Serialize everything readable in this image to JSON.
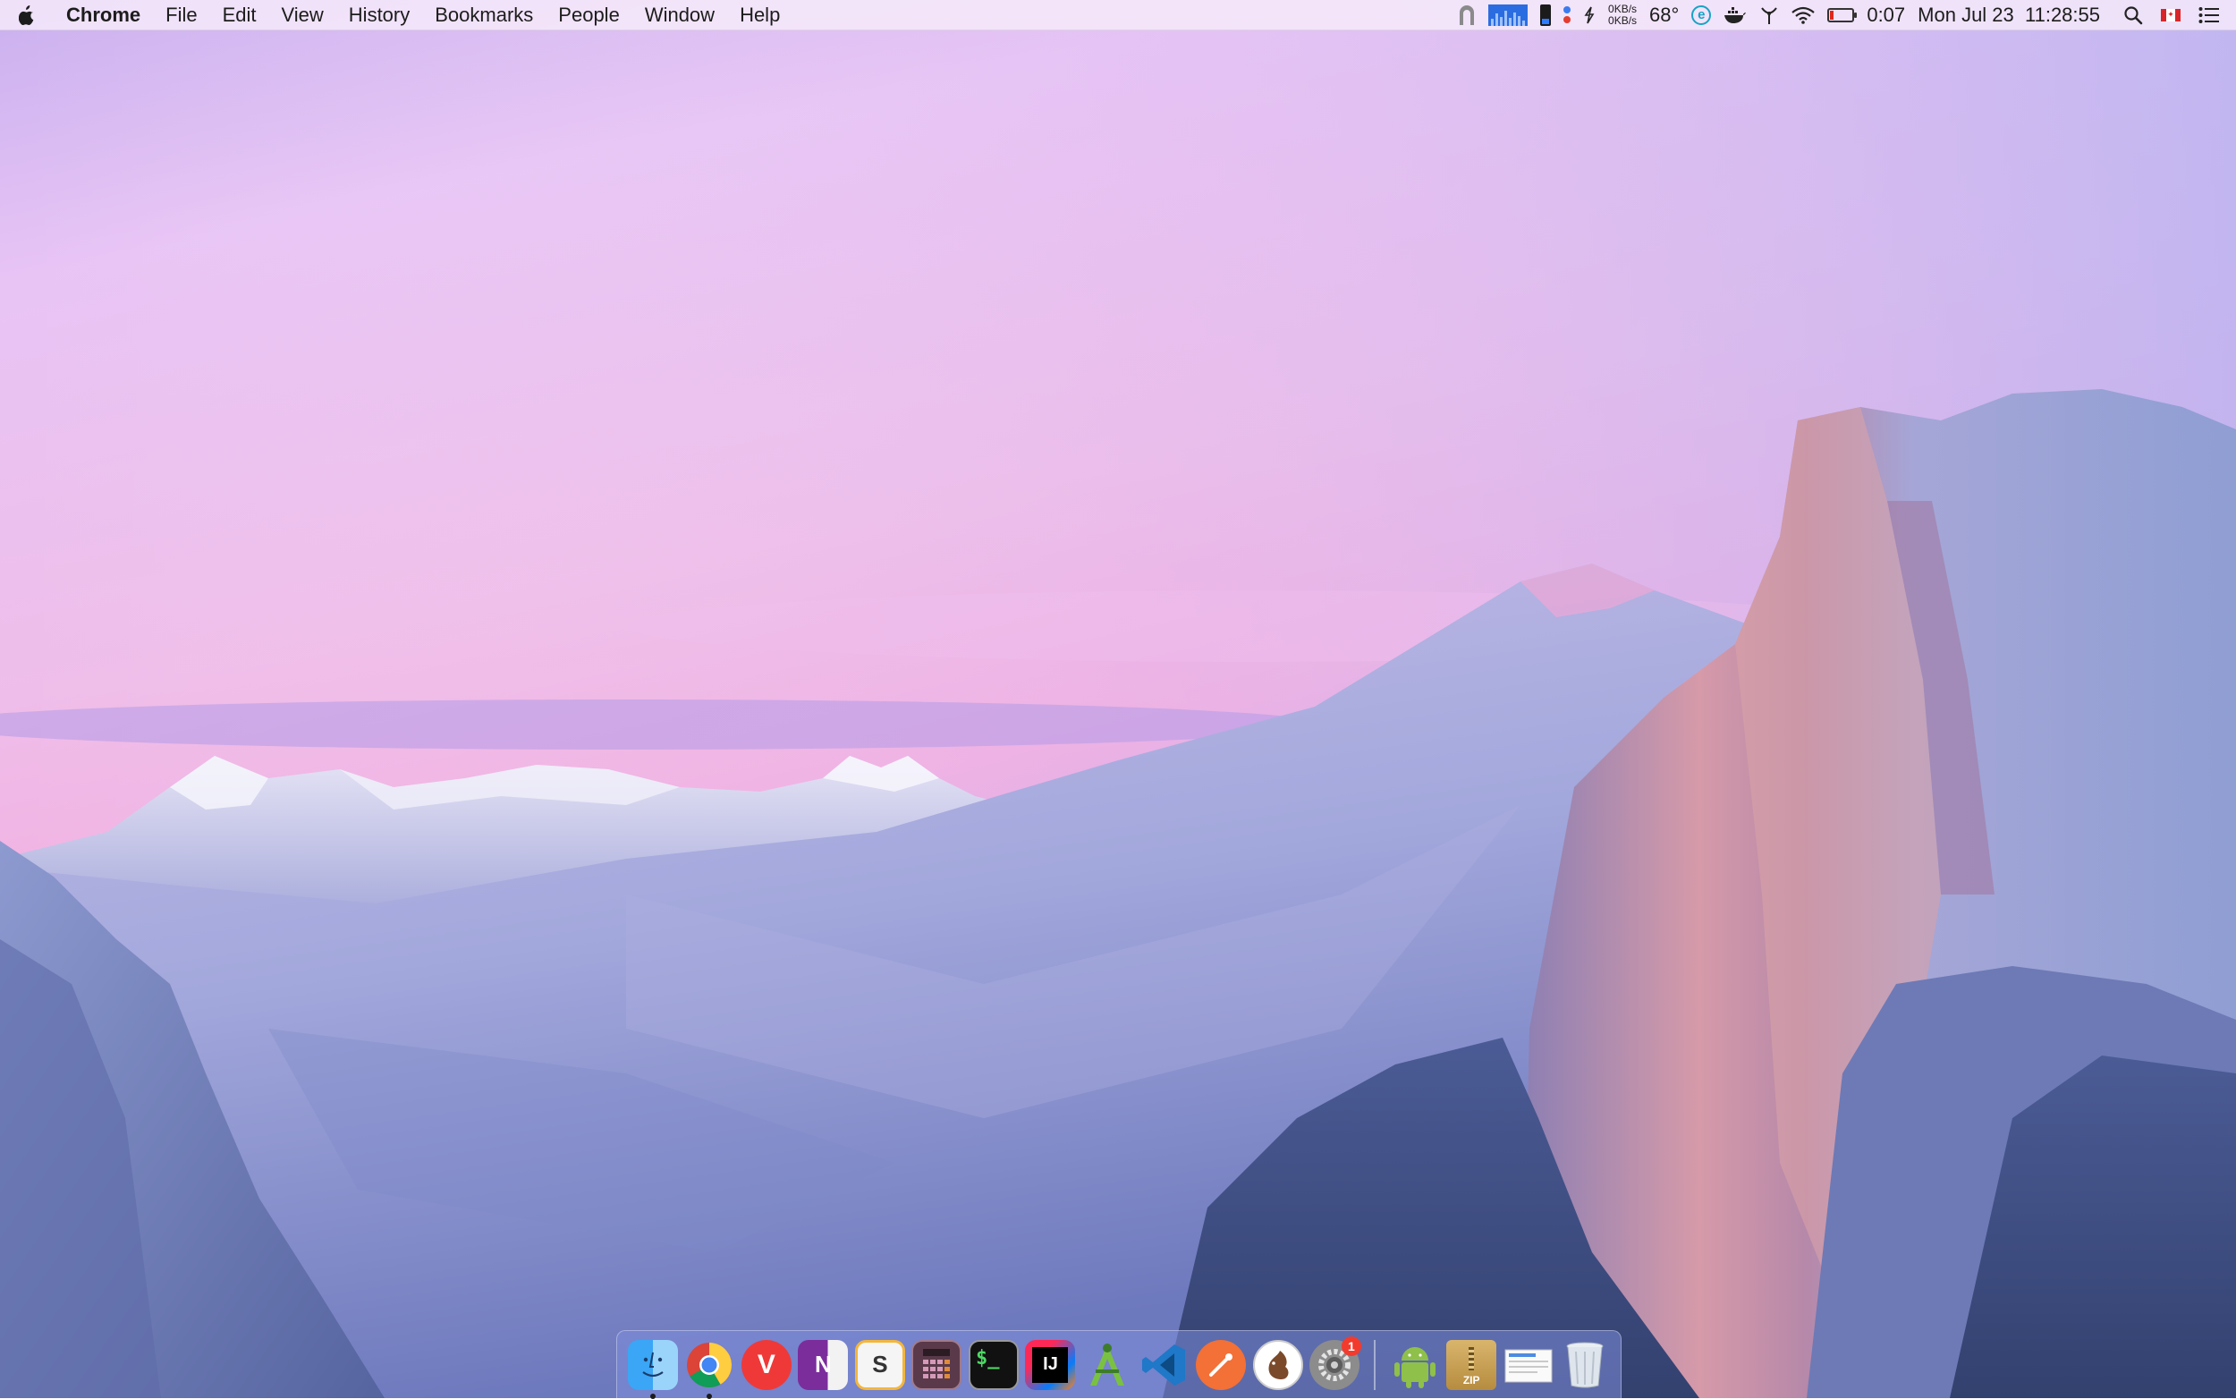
{
  "menubar": {
    "app_name": "Chrome",
    "menus": [
      "File",
      "Edit",
      "View",
      "History",
      "Bookmarks",
      "People",
      "Window",
      "Help"
    ],
    "status": {
      "net_up": "0KB/s",
      "net_down": "0KB/s",
      "temperature": "68°",
      "estat_letter": "e",
      "battery_time": "0:07",
      "battery_level": 0.15,
      "datetime": "Mon Jul 23  11:28:55"
    }
  },
  "icons": {
    "apple": "apple-logo-icon",
    "spotlight": "search-icon",
    "notification": "notification-center-icon",
    "flag": "canada-flag-icon"
  },
  "colors": {
    "sky_top": "#e7c3f5",
    "sky_pink": "#f2b3e8",
    "mountain": "#8e96d6",
    "dock": "#7e8cda",
    "battery_red": "#e0261c"
  },
  "dock": {
    "apps": [
      {
        "name": "Finder",
        "label": "",
        "running": true,
        "badge": ""
      },
      {
        "name": "Google Chrome",
        "label": "",
        "running": true,
        "badge": ""
      },
      {
        "name": "Vivaldi",
        "label": "V",
        "running": false,
        "badge": ""
      },
      {
        "name": "OneNote",
        "label": "N",
        "running": false,
        "badge": ""
      },
      {
        "name": "Sublime",
        "label": "S",
        "running": false,
        "badge": ""
      },
      {
        "name": "Calculator",
        "label": "",
        "running": false,
        "badge": ""
      },
      {
        "name": "Terminal",
        "label": "$_",
        "running": false,
        "badge": ""
      },
      {
        "name": "IntelliJ IDEA",
        "label": "IJ",
        "running": false,
        "badge": ""
      },
      {
        "name": "Android Studio",
        "label": "A",
        "running": false,
        "badge": ""
      },
      {
        "name": "Visual Studio Code",
        "label": "",
        "running": false,
        "badge": ""
      },
      {
        "name": "Postman",
        "label": "",
        "running": false,
        "badge": ""
      },
      {
        "name": "Squirrel",
        "label": "",
        "running": false,
        "badge": ""
      },
      {
        "name": "System Preferences",
        "label": "",
        "running": false,
        "badge": "1"
      }
    ],
    "stacks": [
      {
        "name": "Android File Transfer",
        "label": ""
      },
      {
        "name": "Archive Utility",
        "label": "ZIP"
      },
      {
        "name": "Preview",
        "label": ""
      },
      {
        "name": "Trash",
        "label": ""
      }
    ]
  }
}
